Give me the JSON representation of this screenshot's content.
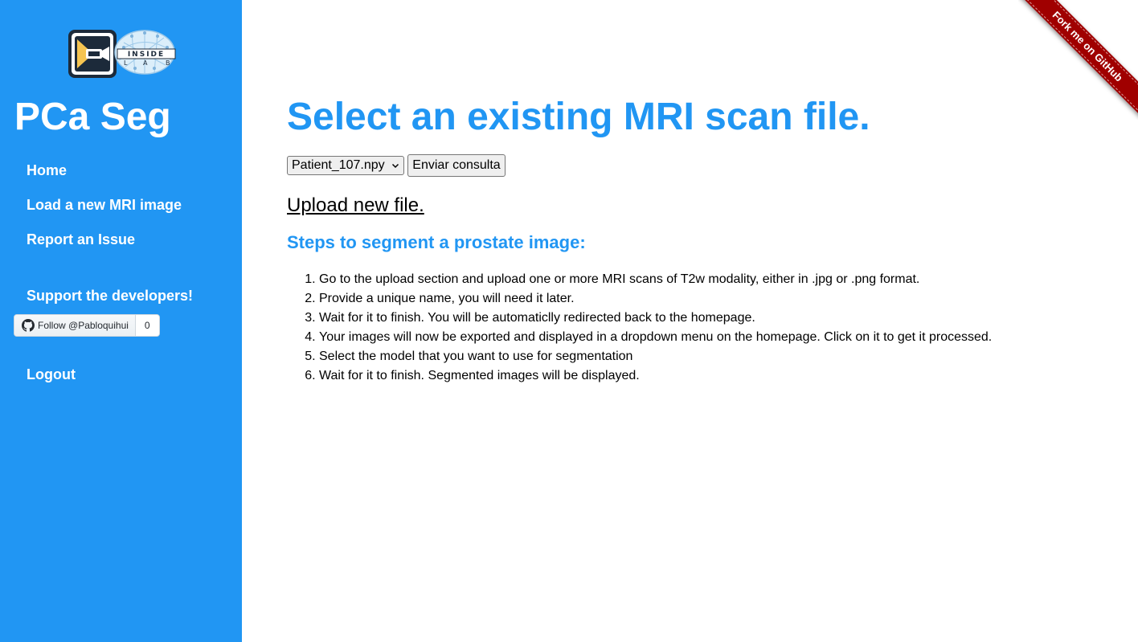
{
  "sidebar": {
    "brand": "PCa Seg",
    "logo": {
      "icon": "camera-logo-icon",
      "text_top": "INSIDE",
      "text_bottom_1": "L",
      "text_bottom_2": "A",
      "text_bottom_3": "B"
    },
    "nav": [
      {
        "label": "Home"
      },
      {
        "label": "Load a new MRI image"
      },
      {
        "label": "Report an Issue"
      },
      {
        "label": "Support the developers!"
      },
      {
        "label": "Logout"
      }
    ],
    "follow": {
      "icon": "github-icon",
      "label": "Follow @Pabloquihui",
      "count": "0"
    },
    "colors": {
      "background": "#2196f3",
      "text": "#ffffff"
    }
  },
  "main": {
    "title": "Select an existing MRI scan file.",
    "select": {
      "selected": "Patient_107.npy",
      "icon": "chevron-down-icon"
    },
    "submit_label": "Enviar consulta",
    "upload_link": "Upload new file.",
    "steps_title": "Steps to segment a prostate image:",
    "steps": [
      "Go to the upload section and upload one or more MRI scans of T2w modality, either in .jpg or .png format.",
      "Provide a unique name, you will need it later.",
      "Wait for it to finish. You will be automaticlly redirected back to the homepage.",
      "Your images will now be exported and displayed in a dropdown menu on the homepage. Click on it to get it processed.",
      "Select the model that you want to use for segmentation",
      "Wait for it to finish. Segmented images will be displayed."
    ],
    "colors": {
      "accent": "#2196f3"
    }
  },
  "ribbon": {
    "label": "Fork me on GitHub",
    "color": "#a00000"
  }
}
